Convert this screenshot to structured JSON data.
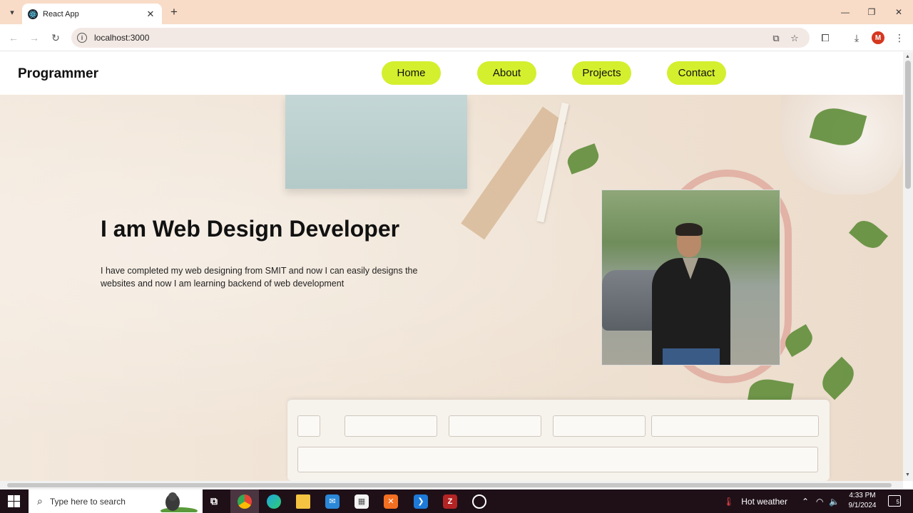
{
  "browser": {
    "tab_title": "React App",
    "tab_close": "✕",
    "new_tab": "+",
    "url": "localhost:3000",
    "profile_initial": "M"
  },
  "site": {
    "brand": "Programmer",
    "nav": [
      {
        "label": "Home"
      },
      {
        "label": "About"
      },
      {
        "label": "Projects"
      },
      {
        "label": "Contact"
      }
    ],
    "accent_color": "#d4ef2e",
    "hero": {
      "title": "I am Web Design Developer",
      "text": "I have completed my web designing from SMIT and now I can easily designs the websites and now I am learning backend of web development"
    }
  },
  "taskbar": {
    "search_placeholder": "Type here to search",
    "weather": "Hot weather",
    "time": "4:33 PM",
    "date": "9/1/2024",
    "notification_count": "5"
  }
}
